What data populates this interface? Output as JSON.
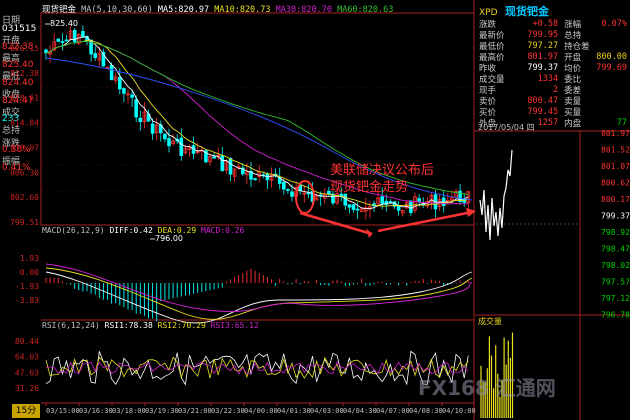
{
  "header": {
    "symbol": "现货钯金",
    "ma_label": "MA(5,10,30,60)",
    "ma5": "MA5:820.97",
    "ma10": "MA10:820.73",
    "ma30": "MA30:820.70",
    "ma60": "MA60:820.63",
    "instrument_title": "现货钯金",
    "instrument_code": "XPD"
  },
  "left_labels": {
    "date": "日期",
    "date_value": "031515",
    "open": "开盘",
    "open_value": "822.38",
    "high": "最高",
    "high_value": "825.40",
    "low": "最低",
    "low_value": "824.40",
    "close": "收盘",
    "close_value": "824.47",
    "volume": "成交",
    "volume_value": "233",
    "total": "总持",
    "change": "涨跌",
    "change_value": "0.36%",
    "amplitude": "振幅",
    "amplitude_value": "0.41%"
  },
  "main_chart": {
    "high_marker": "825.40",
    "low_marker": "796.00",
    "y_ticks": [
      "826.15",
      "822.38",
      "818.61",
      "814.84",
      "810.07",
      "806.30",
      "802.60",
      "799.51"
    ],
    "annotation_line1": "美联储决议公布后",
    "annotation_line2": "现货钯金走势"
  },
  "macd": {
    "label": "MACD(26,12,9)",
    "diff": "DIFF:0.42",
    "dea": "DEA:0.29",
    "macd": "MACD:0.26",
    "y_ticks": [
      "1.93",
      "0.00",
      "-1.93",
      "-3.83"
    ]
  },
  "rsi": {
    "label": "RSI(6,12,24)",
    "rsi1": "RSI1:78.38",
    "rsi2": "RSI2:70.29",
    "rsi3": "RSI3:65.12",
    "y_ticks": [
      "80.44",
      "64.03",
      "47.63",
      "31.26"
    ]
  },
  "time_axis": [
    "03/15:00",
    "03/16:30",
    "03/18:00",
    "03/19:30",
    "03/21:00",
    "03/22:30",
    "04/00:00",
    "04/01:30",
    "04/03:00",
    "04/04:30",
    "04/07:00",
    "04/08:30",
    "04/10:00"
  ],
  "period_tab": "15分",
  "quote": {
    "rows": [
      {
        "l1": "涨跌",
        "v1": "+0.58",
        "c1": "red",
        "l2": "涨幅",
        "v2": "0.07%",
        "c2": "red"
      },
      {
        "l1": "最新价",
        "v1": "799.95",
        "c1": "red",
        "l2": "总持",
        "v2": "",
        "c2": "white"
      },
      {
        "l1": "最低价",
        "v1": "797.27",
        "c1": "yellow",
        "l2": "持仓差",
        "v2": "",
        "c2": "white"
      },
      {
        "l1": "最高价",
        "v1": "801.97",
        "c1": "red",
        "l2": "开盘",
        "v2": "800.00",
        "c2": "yellow"
      },
      {
        "l1": "昨收",
        "v1": "799.37",
        "c1": "white",
        "l2": "均价",
        "v2": "799.69",
        "c2": "red"
      },
      {
        "l1": "成交量",
        "v1": "1334",
        "c1": "red",
        "l2": "委比",
        "v2": "",
        "c2": "white"
      },
      {
        "l1": "现手",
        "v1": "2",
        "c1": "red",
        "l2": "委差",
        "v2": "",
        "c2": "white"
      },
      {
        "l1": "卖价",
        "v1": "800.47",
        "c1": "red",
        "l2": "卖量",
        "v2": "",
        "c2": "white"
      },
      {
        "l1": "买价",
        "v1": "799.45",
        "c1": "red",
        "l2": "买量",
        "v2": "",
        "c2": "white"
      },
      {
        "l1": "外盘",
        "v1": "1257",
        "c1": "red",
        "l2": "内盘",
        "v2": "77",
        "c2": "green"
      }
    ]
  },
  "mini_chart": {
    "date": "2017/05/04",
    "weekday": "四",
    "y_ticks": [
      "801.97",
      "801.52",
      "801.07",
      "800.62",
      "800.17",
      "799.37",
      "798.92",
      "798.47",
      "798.02",
      "797.57",
      "797.12",
      "796.78"
    ],
    "volume_label": "成交量"
  },
  "watermark": "FX168 汇通网",
  "colors": {
    "background": "#000000",
    "candle_up": "#ff3333",
    "candle_down": "#00ffff",
    "ma5": "#ffffff",
    "ma10": "#e8e020",
    "ma30": "#d020d0",
    "ma60": "#30c030",
    "annotation": "#ff3333"
  }
}
